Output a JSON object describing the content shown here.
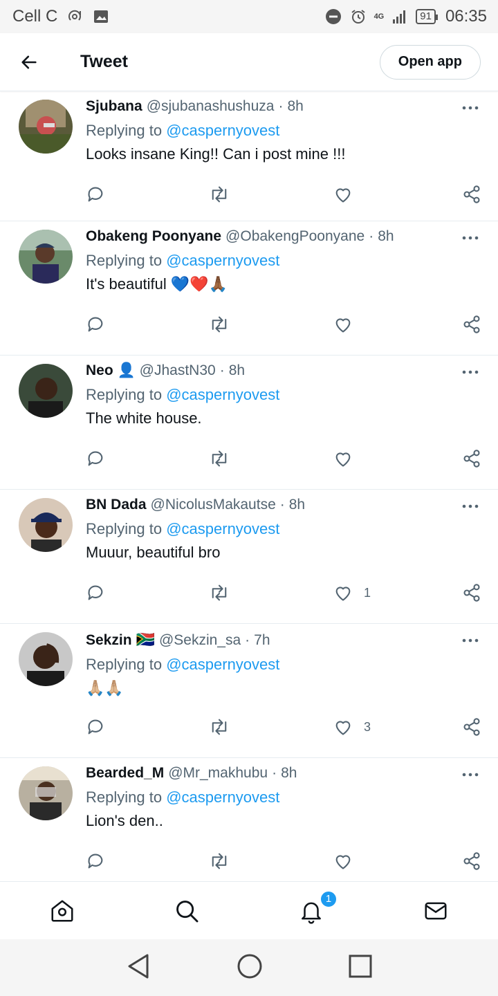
{
  "status_bar": {
    "carrier": "Cell C",
    "network": "4G",
    "battery": "91",
    "time": "06:35"
  },
  "header": {
    "title": "Tweet",
    "open_app_label": "Open app"
  },
  "tweets": [
    {
      "name": "Sjubana",
      "handle": "@sjubanashushuza",
      "time": "8h",
      "flag": "",
      "reply_prefix": "Replying to",
      "reply_to": "@caspernyovest",
      "text": "Looks insane King!! Can i post mine !!!",
      "likes": ""
    },
    {
      "name": "Obakeng Poonyane",
      "handle": "@ObakengPoonyane",
      "time": "8h",
      "flag": "",
      "reply_prefix": "Replying to",
      "reply_to": "@caspernyovest",
      "text": "It's beautiful 💙❤️🙏🏾",
      "likes": ""
    },
    {
      "name": "Neo 👤",
      "handle": "@JhastN30",
      "time": "8h",
      "flag": "",
      "reply_prefix": "Replying to",
      "reply_to": "@caspernyovest",
      "text": "The white house.",
      "likes": ""
    },
    {
      "name": "BN Dada",
      "handle": "@NicolusMakautse",
      "time": "8h",
      "flag": "",
      "reply_prefix": "Replying to",
      "reply_to": "@caspernyovest",
      "text": "Muuur, beautiful bro",
      "likes": "1"
    },
    {
      "name": "Sekzin",
      "handle": "@Sekzin_sa",
      "time": "7h",
      "flag": "🇿🇦",
      "reply_prefix": "Replying to",
      "reply_to": "@caspernyovest",
      "text": "🙏🏼🙏🏼",
      "likes": "3"
    },
    {
      "name": "Bearded_M",
      "handle": "@Mr_makhubu",
      "time": "8h",
      "flag": "",
      "reply_prefix": "Replying to",
      "reply_to": "@caspernyovest",
      "text": "Lion's den..",
      "likes": ""
    }
  ],
  "bottom_nav": {
    "notification_count": "1"
  },
  "colors": {
    "accent": "#1d9bf0",
    "text_secondary": "#536471",
    "border": "#e6ecf0"
  }
}
